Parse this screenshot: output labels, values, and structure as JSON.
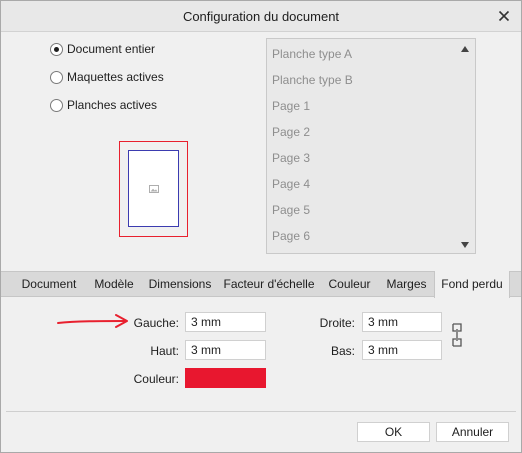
{
  "window": {
    "title": "Configuration du document"
  },
  "scope_options": [
    {
      "label": "Document entier",
      "checked": true
    },
    {
      "label": "Maquettes actives",
      "checked": false
    },
    {
      "label": "Planches actives",
      "checked": false
    }
  ],
  "page_list": {
    "items": [
      "Planche type A",
      "Planche type B",
      "Page 1",
      "Page 2",
      "Page 3",
      "Page 4",
      "Page 5",
      "Page 6"
    ]
  },
  "tabs": [
    {
      "label": "Document",
      "active": false
    },
    {
      "label": "Modèle",
      "active": false
    },
    {
      "label": "Dimensions",
      "active": false
    },
    {
      "label": "Facteur d'échelle",
      "active": false
    },
    {
      "label": "Couleur",
      "active": false
    },
    {
      "label": "Marges",
      "active": false
    },
    {
      "label": "Fond perdu",
      "active": true
    }
  ],
  "bleed": {
    "left_label": "Gauche:",
    "left_value": "3 mm",
    "top_label": "Haut:",
    "top_value": "3 mm",
    "color_label": "Couleur:",
    "color_value": "#e8172f",
    "right_label": "Droite:",
    "right_value": "3 mm",
    "bottom_label": "Bas:",
    "bottom_value": "3 mm"
  },
  "buttons": {
    "ok": "OK",
    "cancel": "Annuler"
  },
  "colors": {
    "preview_border": "#e8202e",
    "page_outline": "#3b3bb0",
    "annotation_arrow": "#e8202e"
  },
  "icons": {
    "close": "close-icon",
    "link": "chain-link-icon",
    "scroll_up": "triangle-up-icon",
    "scroll_down": "triangle-down-icon"
  }
}
